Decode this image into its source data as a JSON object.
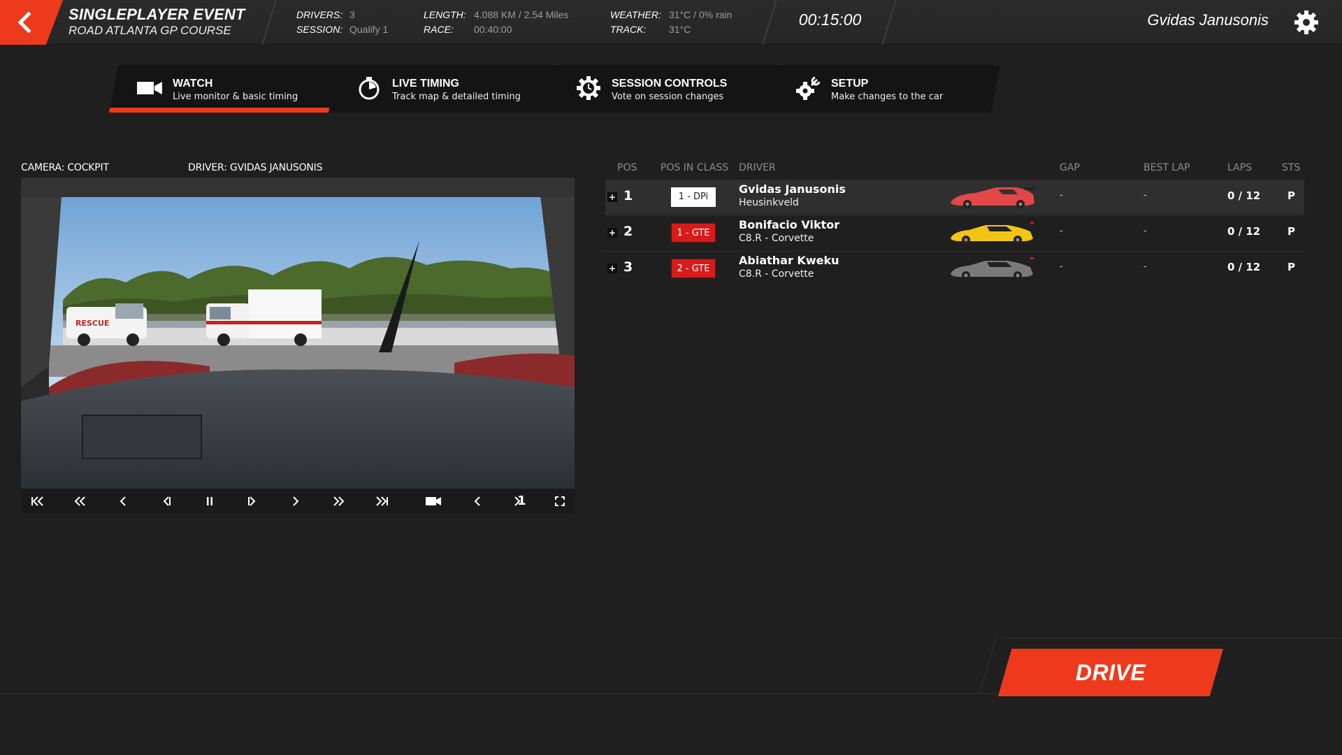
{
  "header": {
    "event_title": "SINGLEPLAYER EVENT",
    "track_name": "ROAD ATLANTA GP COURSE",
    "drivers_label": "DRIVERS:",
    "drivers_value": "3",
    "session_label": "SESSION:",
    "session_value": "Qualify 1",
    "length_label": "LENGTH:",
    "length_value": "4.088 KM / 2.54 Miles",
    "race_label": "RACE:",
    "race_value": "00:40:00",
    "weather_label": "WEATHER:",
    "weather_value": "31°C / 0% rain",
    "track_label": "TRACK:",
    "track_value": "31°C",
    "timer": "00:15:00",
    "user_name": "Gvidas Janusonis",
    "back_icon": "chevron-left-icon",
    "settings_icon": "gear-icon"
  },
  "tabs": [
    {
      "label": "WATCH",
      "sub": "Live monitor & basic timing",
      "icon": "video-camera-icon",
      "active": true
    },
    {
      "label": "LIVE TIMING",
      "sub": "Track map & detailed timing",
      "icon": "stopwatch-icon",
      "active": false
    },
    {
      "label": "SESSION CONTROLS",
      "sub": "Vote on session changes",
      "icon": "gear-clock-icon",
      "active": false
    },
    {
      "label": "SETUP",
      "sub": "Make changes to the car",
      "icon": "gear-wrench-icon",
      "active": false
    }
  ],
  "camera": {
    "camera_text": "CAMERA: COCKPIT",
    "driver_text": "DRIVER: GVIDAS JANUSONIS",
    "page": "1",
    "controls": [
      "skip-to-start-icon",
      "fast-rewind-icon",
      "rewind-icon",
      "step-back-icon",
      "pause-icon",
      "step-forward-icon",
      "play-forward-icon",
      "fast-forward-icon",
      "skip-to-end-icon",
      "camera-icon",
      "prev-camera-icon",
      "next-camera-icon",
      "fullscreen-icon"
    ]
  },
  "standings": {
    "columns": {
      "pos": "POS",
      "pos_in_class": "POS IN CLASS",
      "driver": "DRIVER",
      "gap": "GAP",
      "best_lap": "BEST LAP",
      "laps": "LAPS",
      "sts": "STS"
    },
    "rows": [
      {
        "pos": "1",
        "class": "1 - DPi",
        "name": "Gvidas Janusonis",
        "car": "Heusinkveld",
        "gap": "-",
        "best": "-",
        "laps": "0 / 12",
        "sts": "P",
        "car_color": "#e24848"
      },
      {
        "pos": "2",
        "class": "1 - GTE",
        "name": "Bonifacio Viktor",
        "car": "C8.R - Corvette",
        "gap": "-",
        "best": "-",
        "laps": "0 / 12",
        "sts": "P",
        "car_color": "#f2c415"
      },
      {
        "pos": "3",
        "class": "2 - GTE",
        "name": "Abiathar Kweku",
        "car": "C8.R - Corvette",
        "gap": "-",
        "best": "-",
        "laps": "0 / 12",
        "sts": "P",
        "car_color": "#7a7a7a"
      }
    ],
    "expand_glyph": "+"
  },
  "drive_button": "DRIVE",
  "colors": {
    "accent": "#ee3a1c",
    "background": "#1f1f1f",
    "gte_badge": "#d71a1a"
  }
}
